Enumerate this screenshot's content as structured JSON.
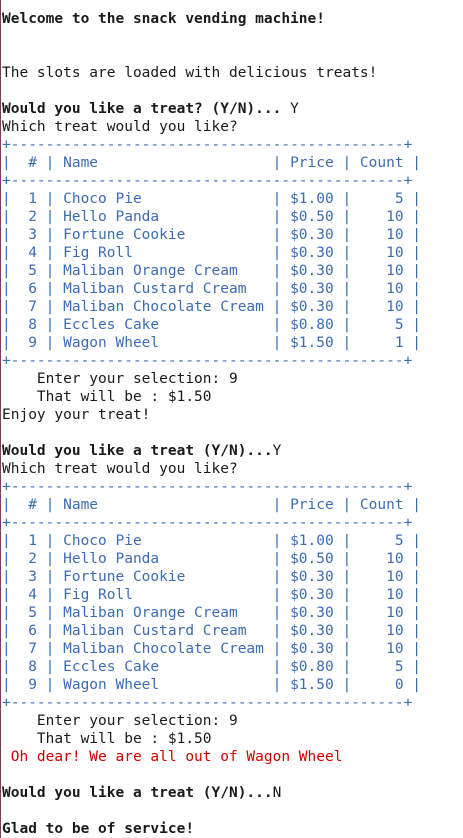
{
  "messages": {
    "welcome": "Welcome to the snack vending machine!",
    "loaded": "The slots are loaded with delicious treats!",
    "prompt1": "Would you like a treat? (Y/N)...",
    "answer1": " Y",
    "which1": "Which treat would you like?",
    "selection1": "    Enter your selection: 9",
    "price1": "    That will be : $1.50",
    "enjoy": "Enjoy your treat!",
    "prompt2": "Would you like a treat (Y/N)...",
    "answer2": "Y",
    "which2": "Which treat would you like?",
    "selection2": "    Enter your selection: 9",
    "price2": "    That will be : $1.50",
    "out_of_stock": " Oh dear! We are all out of Wagon Wheel",
    "prompt3": "Would you like a treat (Y/N)...",
    "answer3": "N",
    "goodbye": "Glad to be of service!"
  },
  "tables": [
    {
      "border": "+---------------------------------------------+",
      "header": "|  # | Name                    | Price | Count |",
      "rows": [
        "|  1 | Choco Pie               | $1.00 |     5 |",
        "|  2 | Hello Panda             | $0.50 |    10 |",
        "|  3 | Fortune Cookie          | $0.30 |    10 |",
        "|  4 | Fig Roll                | $0.30 |    10 |",
        "|  5 | Maliban Orange Cream    | $0.30 |    10 |",
        "|  6 | Maliban Custard Cream   | $0.30 |    10 |",
        "|  7 | Maliban Chocolate Cream | $0.30 |    10 |",
        "|  8 | Eccles Cake             | $0.80 |     5 |",
        "|  9 | Wagon Wheel             | $1.50 |     1 |"
      ]
    },
    {
      "border": "+---------------------------------------------+",
      "header": "|  # | Name                    | Price | Count |",
      "rows": [
        "|  1 | Choco Pie               | $1.00 |     5 |",
        "|  2 | Hello Panda             | $0.50 |    10 |",
        "|  3 | Fortune Cookie          | $0.30 |    10 |",
        "|  4 | Fig Roll                | $0.30 |    10 |",
        "|  5 | Maliban Orange Cream    | $0.30 |    10 |",
        "|  6 | Maliban Custard Cream   | $0.30 |    10 |",
        "|  7 | Maliban Chocolate Cream | $0.30 |    10 |",
        "|  8 | Eccles Cake             | $0.80 |     5 |",
        "|  9 | Wagon Wheel             | $1.50 |     0 |"
      ]
    }
  ],
  "colors": {
    "text": "#1a1a1a",
    "table": "#3b6db3",
    "error": "#cc0000",
    "background": "#ffffff"
  }
}
